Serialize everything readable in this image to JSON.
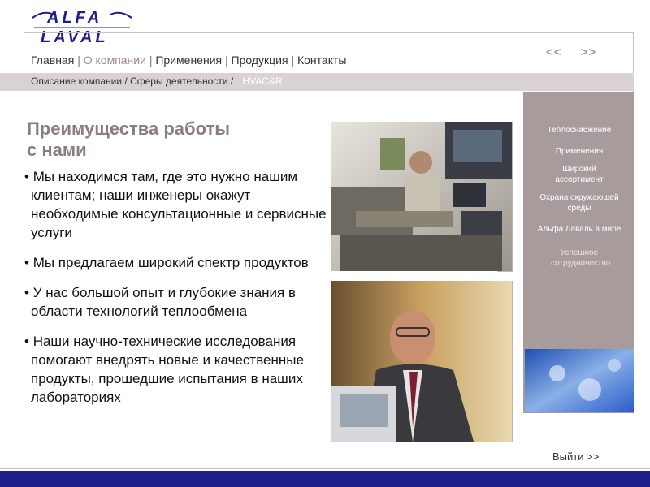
{
  "brand": {
    "logo_text": "ALFA LAVAL"
  },
  "nav": {
    "items": [
      "Главная",
      "О компании",
      "Применения",
      "Продукция",
      "Контакты"
    ],
    "prev": "<<",
    "next": ">>"
  },
  "breadcrumb": {
    "items": [
      "Описание компании",
      "Сферы деятельности"
    ],
    "current": "HVAC&R"
  },
  "main": {
    "title_line1": "Преимущества работы",
    "title_line2": "с нами",
    "bullets": [
      "Мы находимся там, где это нужно нашим клиентам; наши инженеры окажут необходимые консультационные и сервисные услуги",
      "Мы предлагаем широкий спектр продуктов",
      "У нас большой опыт и глубокие знания в области технологий теплообмена",
      "Наши научно-технические исследования помогают внедрять новые и качественные продукты, прошедшие испытания в наших лабораториях"
    ]
  },
  "sidebar": {
    "items": [
      "Теплоснабжение",
      "Применения",
      "Широкий ассортимент",
      "Охрана окружающей среды",
      "Альфа Лаваль в мире",
      "Успешное сотрудничество"
    ]
  },
  "footer": {
    "exit": "Выйти >>"
  },
  "colors": {
    "brand_blue": "#1e1e8a",
    "panel": "#a79c9b",
    "heading": "#8a7e7d",
    "crumb_bar": "#d8d2d2"
  }
}
